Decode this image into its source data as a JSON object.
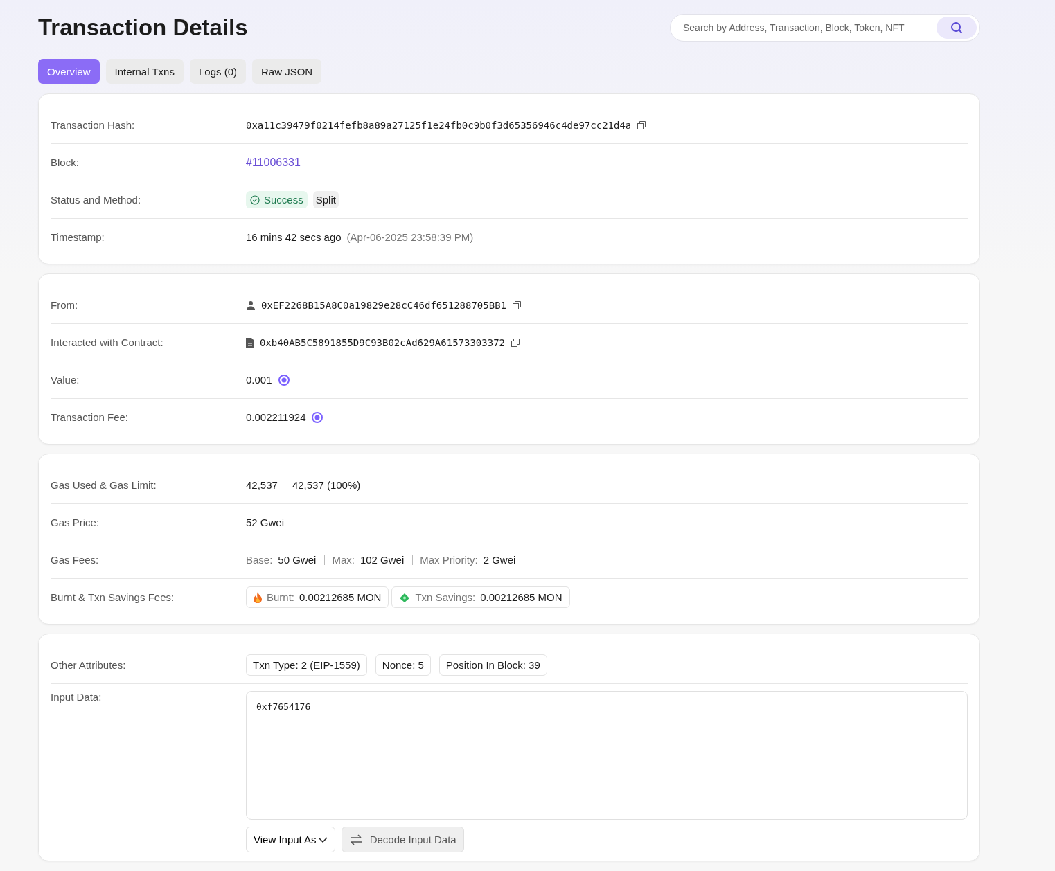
{
  "title": "Transaction Details",
  "search": {
    "placeholder": "Search by Address, Transaction, Block, Token, NFT"
  },
  "tabs": [
    {
      "label": "Overview",
      "selected": true
    },
    {
      "label": "Internal Txns",
      "selected": false
    },
    {
      "label": "Logs (0)",
      "selected": false
    },
    {
      "label": "Raw JSON",
      "selected": false
    }
  ],
  "cards": [
    {
      "rows": [
        {
          "kind": "hash",
          "label": "Transaction Hash:",
          "value": "0xa11c39479f0214fefb8a89a27125f1e24fb0c9b0f3d65356946c4de97cc21d4a"
        },
        {
          "kind": "link",
          "label": "Block:",
          "value": "#11006331"
        },
        {
          "kind": "status",
          "label": "Status and Method:",
          "status": "Success",
          "method": "Split"
        },
        {
          "kind": "time",
          "label": "Timestamp:",
          "value": "16 mins 42 secs ago",
          "detail": "(Apr-06-2025 23:58:39 PM)"
        }
      ]
    },
    {
      "rows": [
        {
          "kind": "sender",
          "label": "From:",
          "value": "0xEF2268B15A8C0a19829e28cC46df651288705BB1"
        },
        {
          "kind": "contract",
          "label": "Interacted with Contract:",
          "value": "0xb40AB5C5891855D9C93B02cAd629A61573303372"
        },
        {
          "kind": "amount",
          "label": "Value:",
          "value": "0.001"
        },
        {
          "kind": "amount",
          "label": "Transaction Fee:",
          "value": "0.002211924"
        }
      ]
    },
    {
      "rows": [
        {
          "kind": "gas",
          "label": "Gas Used & Gas Limit:",
          "used": "42,537",
          "limit": "42,537 (100%)"
        },
        {
          "kind": "text",
          "label": "Gas Price:",
          "value": "52 Gwei"
        },
        {
          "kind": "fees",
          "label": "Gas Fees:",
          "fees": [
            {
              "name": "Base:",
              "value": "50 Gwei"
            },
            {
              "name": "Max:",
              "value": "102 Gwei"
            },
            {
              "name": "Max Priority:",
              "value": "2 Gwei"
            }
          ]
        },
        {
          "kind": "burnt",
          "label": "Burnt & Txn Savings Fees:",
          "chips": [
            {
              "name": "Burnt:",
              "value": "0.00212685 MON"
            },
            {
              "name": "Txn Savings:",
              "value": "0.00212685 MON"
            }
          ]
        }
      ]
    },
    {
      "rows": [
        {
          "kind": "tags",
          "label": "Other Attributes:",
          "tags": [
            "Txn Type: 2 (EIP-1559)",
            "Nonce: 5",
            "Position In Block: 39"
          ]
        },
        {
          "kind": "input",
          "label": "Input Data:",
          "value": "0xf7654176",
          "view": "View Input As",
          "decode": "Decode Input Data"
        }
      ]
    }
  ]
}
